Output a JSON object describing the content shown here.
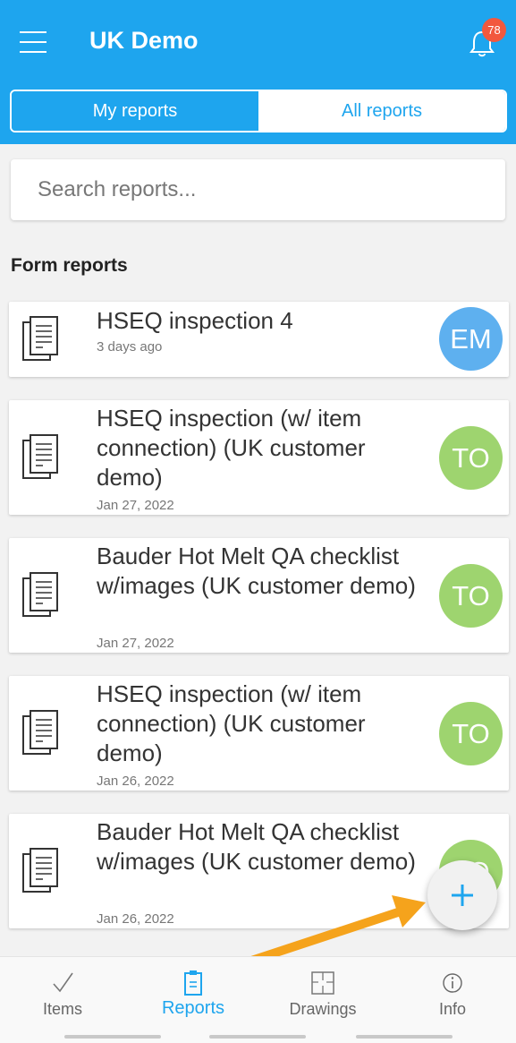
{
  "header": {
    "title": "UK Demo",
    "notification_count": "78",
    "accent_color": "#1ea5ee"
  },
  "tabs": {
    "my_reports": "My reports",
    "all_reports": "All reports",
    "active": "my_reports"
  },
  "search": {
    "placeholder": "Search reports..."
  },
  "section": {
    "title": "Form reports"
  },
  "reports": [
    {
      "title": "HSEQ inspection 4",
      "date": "3 days ago",
      "initials": "EM",
      "avatar_color": "#5eb0ef"
    },
    {
      "title": "HSEQ inspection (w/ item connection) (UK customer demo)",
      "date": "Jan 27, 2022",
      "initials": "TO",
      "avatar_color": "#9ed46f"
    },
    {
      "title": "Bauder Hot Melt QA checklist w/images (UK customer demo)",
      "date": "Jan 27, 2022",
      "initials": "TO",
      "avatar_color": "#9ed46f"
    },
    {
      "title": "HSEQ inspection (w/ item connection) (UK customer demo)",
      "date": "Jan 26, 2022",
      "initials": "TO",
      "avatar_color": "#9ed46f"
    },
    {
      "title": "Bauder Hot Melt QA checklist w/images (UK customer demo)",
      "date": "Jan 26, 2022",
      "initials": "TO",
      "avatar_color": "#9ed46f"
    }
  ],
  "fab": {
    "icon": "plus-icon",
    "label": "+"
  },
  "bottom_nav": [
    {
      "label": "Items",
      "icon": "check-icon"
    },
    {
      "label": "Reports",
      "icon": "clipboard-icon",
      "active": true
    },
    {
      "label": "Drawings",
      "icon": "floorplan-icon"
    },
    {
      "label": "Info",
      "icon": "info-icon"
    }
  ]
}
